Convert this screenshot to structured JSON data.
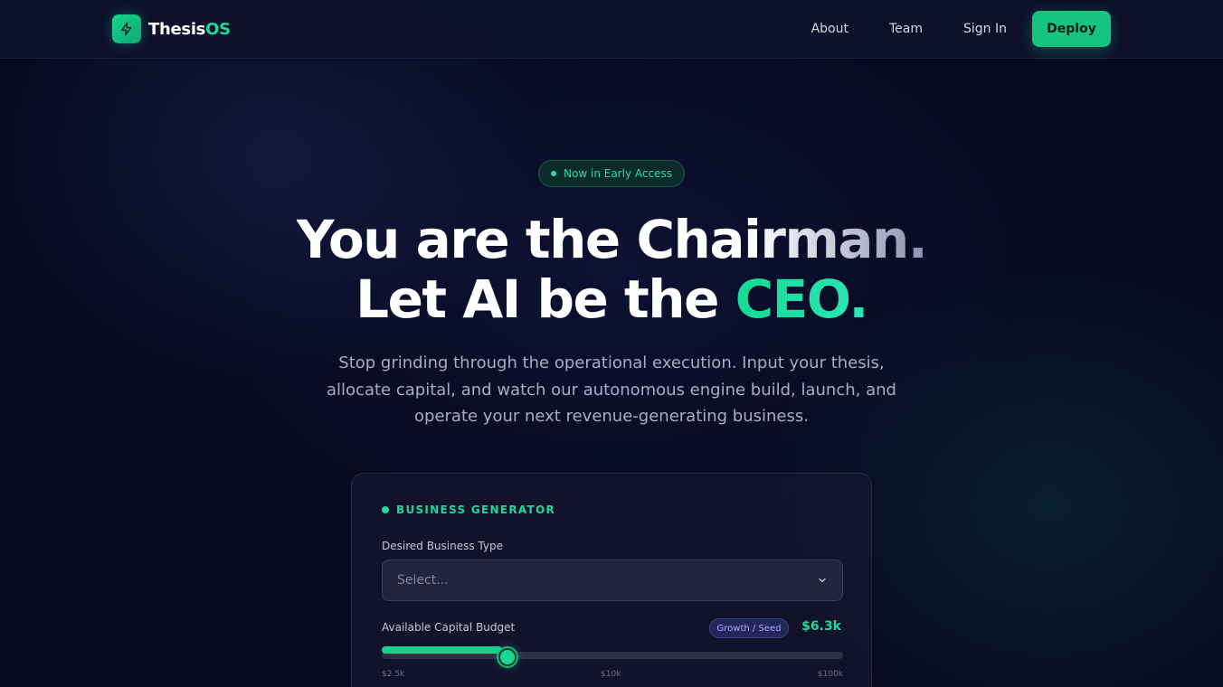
{
  "nav": {
    "brand": {
      "name": "Thesis",
      "suffix": "OS"
    },
    "links": [
      "About",
      "Team",
      "Sign In"
    ],
    "cta": "Deploy"
  },
  "hero": {
    "badge": "Now in Early Access",
    "headline_line1": "You are the Chairman.",
    "headline_line2_a": "Let AI be the ",
    "headline_line2_b": "CEO.",
    "subtitle": "Stop grinding through the operational execution. Input your thesis, allocate capital, and watch our autonomous engine build, launch, and operate your next revenue-generating business."
  },
  "generator": {
    "title": "BUSINESS GENERATOR",
    "business_type_label": "Desired Business Type",
    "business_type_value": "Select...",
    "budget_label": "Available Capital Budget",
    "budget_tier": "Growth / Seed",
    "budget_value": "$6.3k",
    "budget_fraction": 0.26,
    "budget_ticks": [
      "$2.5k",
      "$10k",
      "$100k"
    ]
  },
  "colors": {
    "accent": "#14c47f",
    "background": "#070a1f",
    "tier": "#a7acff"
  }
}
